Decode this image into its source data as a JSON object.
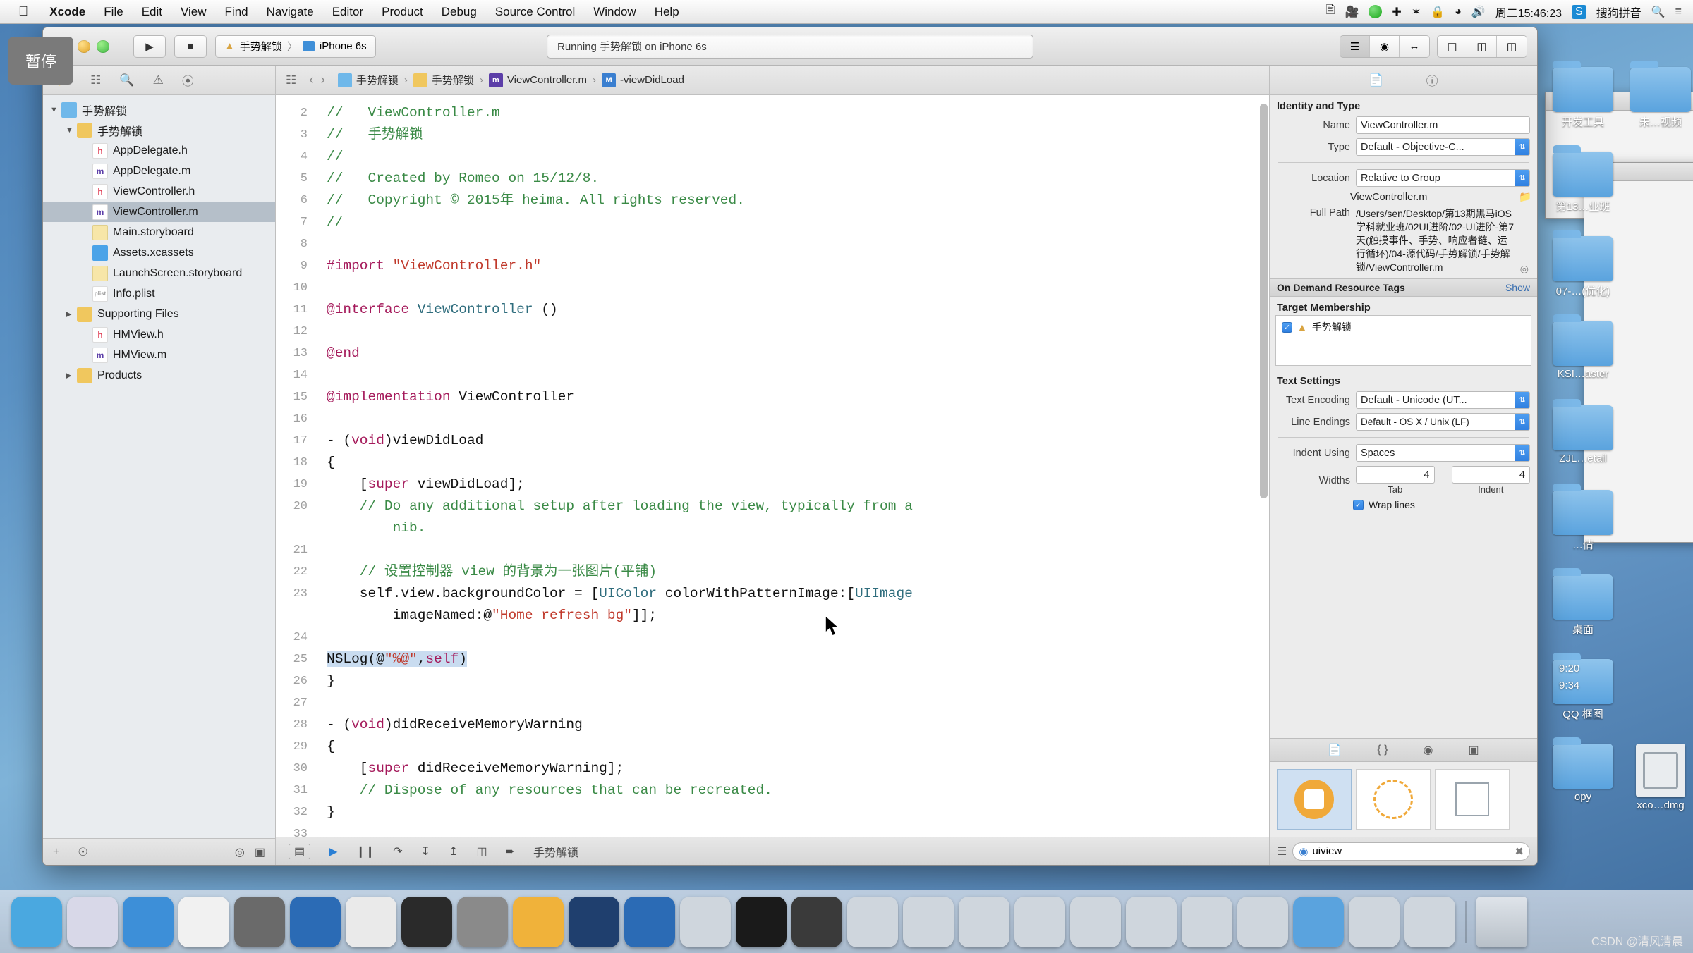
{
  "menubar": {
    "apple": "",
    "items": [
      "Xcode",
      "File",
      "Edit",
      "View",
      "Find",
      "Navigate",
      "Editor",
      "Product",
      "Debug",
      "Source Control",
      "Window",
      "Help"
    ],
    "status_icons": [
      "screen-share-icon",
      "screen-record-icon",
      "play-circle-icon",
      "airplane-icon",
      "bluetooth-icon",
      "lock-icon",
      "wifi-icon",
      "volume-icon"
    ],
    "clock": "周二15:46:23",
    "input_method_badge": "S",
    "input_method": "搜狗拼音",
    "search_icon": "search-icon",
    "notification_icon": "notification-list-icon"
  },
  "tooltip": {
    "text": "暂停"
  },
  "toolbar": {
    "run_icon": "▶",
    "stop_icon": "■",
    "scheme_project": "手势解锁",
    "scheme_separator": "〉",
    "scheme_device": "iPhone 6s",
    "status": "Running 手势解锁 on iPhone 6s",
    "editor_modes": [
      "standard-editor-icon",
      "assistant-editor-icon",
      "version-editor-icon"
    ],
    "view_toggles": [
      "navigator-toggle-icon",
      "debug-toggle-icon",
      "utilities-toggle-icon"
    ]
  },
  "navigator": {
    "tabs": [
      "project-navigator-icon",
      "symbol-navigator-icon",
      "find-navigator-icon",
      "issue-navigator-icon",
      "test-navigator-icon"
    ],
    "tree": [
      {
        "label": "手势解锁",
        "icon": "proj",
        "depth": 0,
        "tri": "▼",
        "selected": false
      },
      {
        "label": "手势解锁",
        "icon": "folder",
        "depth": 1,
        "tri": "▼",
        "selected": false
      },
      {
        "label": "AppDelegate.h",
        "icon": "h",
        "depth": 2,
        "tri": "",
        "selected": false
      },
      {
        "label": "AppDelegate.m",
        "icon": "m",
        "depth": 2,
        "tri": "",
        "selected": false
      },
      {
        "label": "ViewController.h",
        "icon": "h",
        "depth": 2,
        "tri": "",
        "selected": false
      },
      {
        "label": "ViewController.m",
        "icon": "m",
        "depth": 2,
        "tri": "",
        "selected": true
      },
      {
        "label": "Main.storyboard",
        "icon": "sb",
        "depth": 2,
        "tri": "",
        "selected": false
      },
      {
        "label": "Assets.xcassets",
        "icon": "xc",
        "depth": 2,
        "tri": "",
        "selected": false
      },
      {
        "label": "LaunchScreen.storyboard",
        "icon": "sb",
        "depth": 2,
        "tri": "",
        "selected": false
      },
      {
        "label": "Info.plist",
        "icon": "plist",
        "depth": 2,
        "tri": "",
        "selected": false
      },
      {
        "label": "Supporting Files",
        "icon": "folder",
        "depth": 1,
        "tri": "▶",
        "selected": false
      },
      {
        "label": "HMView.h",
        "icon": "h",
        "depth": 2,
        "tri": "",
        "selected": false
      },
      {
        "label": "HMView.m",
        "icon": "m",
        "depth": 2,
        "tri": "",
        "selected": false
      },
      {
        "label": "Products",
        "icon": "folder",
        "depth": 1,
        "tri": "▶",
        "selected": false
      }
    ],
    "footer_icons": [
      "add-icon",
      "filter-icon",
      "recent-icon",
      "source-control-icon"
    ]
  },
  "jumpbar": {
    "related_icon": "related-files-icon",
    "back_icon": "‹",
    "forward_icon": "›",
    "crumbs": [
      {
        "label": "手势解锁",
        "icon": "proj"
      },
      {
        "label": "手势解锁",
        "icon": "folder"
      },
      {
        "label": "ViewController.m",
        "icon": "m"
      },
      {
        "label": "-viewDidLoad",
        "icon": "M"
      }
    ]
  },
  "editor": {
    "first_line_number": 2,
    "lines": [
      {
        "n": 2,
        "tokens": [
          {
            "t": "//   ViewController.m",
            "c": "cm"
          }
        ]
      },
      {
        "n": 3,
        "tokens": [
          {
            "t": "//   手势解锁",
            "c": "cm"
          }
        ]
      },
      {
        "n": 4,
        "tokens": [
          {
            "t": "//",
            "c": "cm"
          }
        ]
      },
      {
        "n": 5,
        "tokens": [
          {
            "t": "//   Created by Romeo on 15/12/8.",
            "c": "cm"
          }
        ]
      },
      {
        "n": 6,
        "tokens": [
          {
            "t": "//   Copyright © 2015年 heima. All rights reserved.",
            "c": "cm"
          }
        ]
      },
      {
        "n": 7,
        "tokens": [
          {
            "t": "//",
            "c": "cm"
          }
        ]
      },
      {
        "n": 8,
        "tokens": [
          {
            "t": "",
            "c": ""
          }
        ]
      },
      {
        "n": 9,
        "tokens": [
          {
            "t": "#import ",
            "c": "pre"
          },
          {
            "t": "\"ViewController.h\"",
            "c": "str"
          }
        ]
      },
      {
        "n": 10,
        "tokens": [
          {
            "t": "",
            "c": ""
          }
        ]
      },
      {
        "n": 11,
        "tokens": [
          {
            "t": "@interface ",
            "c": "kw"
          },
          {
            "t": "ViewController",
            "c": "ty"
          },
          {
            "t": " ()",
            "c": ""
          }
        ]
      },
      {
        "n": 12,
        "tokens": [
          {
            "t": "",
            "c": ""
          }
        ]
      },
      {
        "n": 13,
        "tokens": [
          {
            "t": "@end",
            "c": "kw"
          }
        ]
      },
      {
        "n": 14,
        "tokens": [
          {
            "t": "",
            "c": ""
          }
        ]
      },
      {
        "n": 15,
        "tokens": [
          {
            "t": "@implementation ",
            "c": "kw"
          },
          {
            "t": "ViewController",
            "c": ""
          }
        ]
      },
      {
        "n": 16,
        "tokens": [
          {
            "t": "",
            "c": ""
          }
        ]
      },
      {
        "n": 17,
        "tokens": [
          {
            "t": "- (",
            "c": ""
          },
          {
            "t": "void",
            "c": "kw"
          },
          {
            "t": ")viewDidLoad",
            "c": ""
          }
        ]
      },
      {
        "n": 18,
        "tokens": [
          {
            "t": "{",
            "c": ""
          }
        ]
      },
      {
        "n": 19,
        "tokens": [
          {
            "t": "    [",
            "c": ""
          },
          {
            "t": "super",
            "c": "kw"
          },
          {
            "t": " viewDidLoad];",
            "c": ""
          }
        ]
      },
      {
        "n": 20,
        "tokens": [
          {
            "t": "    // Do any additional setup after loading the view, typically from a",
            "c": "cm"
          }
        ]
      },
      {
        "n": "",
        "tokens": [
          {
            "t": "        nib.",
            "c": "cm"
          }
        ]
      },
      {
        "n": 21,
        "tokens": [
          {
            "t": "",
            "c": ""
          }
        ]
      },
      {
        "n": 22,
        "tokens": [
          {
            "t": "    // 设置控制器 view 的背景为一张图片(平铺)",
            "c": "cm"
          }
        ]
      },
      {
        "n": 23,
        "tokens": [
          {
            "t": "    self.view.backgroundColor = [",
            "c": ""
          },
          {
            "t": "UIColor",
            "c": "ty"
          },
          {
            "t": " colorWithPatternImage:[",
            "c": ""
          },
          {
            "t": "UIImage",
            "c": "ty"
          }
        ]
      },
      {
        "n": "",
        "tokens": [
          {
            "t": "        imageNamed:@",
            "c": ""
          },
          {
            "t": "\"Home_refresh_bg\"",
            "c": "str"
          },
          {
            "t": "]];",
            "c": ""
          }
        ]
      },
      {
        "n": 24,
        "tokens": [
          {
            "t": "",
            "c": ""
          }
        ]
      },
      {
        "n": 25,
        "tokens": [
          {
            "t": "NSLog(@",
            "c": "",
            "sel": true
          },
          {
            "t": "\"%@\"",
            "c": "str",
            "sel": true
          },
          {
            "t": ",",
            "c": "",
            "sel": true
          },
          {
            "t": "self",
            "c": "kw",
            "sel": true
          },
          {
            "t": ")",
            "c": "",
            "sel": true
          }
        ]
      },
      {
        "n": 26,
        "tokens": [
          {
            "t": "}",
            "c": ""
          }
        ]
      },
      {
        "n": 27,
        "tokens": [
          {
            "t": "",
            "c": ""
          }
        ]
      },
      {
        "n": 28,
        "tokens": [
          {
            "t": "- (",
            "c": ""
          },
          {
            "t": "void",
            "c": "kw"
          },
          {
            "t": ")didReceiveMemoryWarning",
            "c": ""
          }
        ]
      },
      {
        "n": 29,
        "tokens": [
          {
            "t": "{",
            "c": ""
          }
        ]
      },
      {
        "n": 30,
        "tokens": [
          {
            "t": "    [",
            "c": ""
          },
          {
            "t": "super",
            "c": "kw"
          },
          {
            "t": " didReceiveMemoryWarning];",
            "c": ""
          }
        ]
      },
      {
        "n": 31,
        "tokens": [
          {
            "t": "    // Dispose of any resources that can be recreated.",
            "c": "cm"
          }
        ]
      },
      {
        "n": 32,
        "tokens": [
          {
            "t": "}",
            "c": ""
          }
        ]
      },
      {
        "n": 33,
        "tokens": [
          {
            "t": "",
            "c": ""
          }
        ]
      }
    ],
    "footer": {
      "icons": [
        "console-toggle-icon",
        "continue-icon",
        "pause-icon",
        "step-over-icon",
        "step-into-icon",
        "step-out-icon",
        "view-hierarchy-icon",
        "location-icon"
      ],
      "label": "手势解锁"
    }
  },
  "inspector": {
    "tabs": [
      "file-inspector-icon",
      "quick-help-icon"
    ],
    "identity": {
      "header": "Identity and Type",
      "name_label": "Name",
      "name_value": "ViewController.m",
      "type_label": "Type",
      "type_value": "Default - Objective-C...",
      "location_label": "Location",
      "location_value": "Relative to Group",
      "location_file": "ViewController.m",
      "fullpath_label": "Full Path",
      "fullpath_value": "/Users/sen/Desktop/第13期黑马iOS学科就业班/02UI进阶/02-UI进阶-第7天(触摸事件、手势、响应者链、运行循环)/04-源代码/手势解锁/手势解锁/ViewController.m"
    },
    "ondemand": {
      "header": "On Demand Resource Tags",
      "show": "Show"
    },
    "target_membership": {
      "header": "Target Membership",
      "items": [
        {
          "label": "手势解锁",
          "checked": true
        }
      ]
    },
    "text_settings": {
      "header": "Text Settings",
      "encoding_label": "Text Encoding",
      "encoding_value": "Default - Unicode (UT...",
      "endings_label": "Line Endings",
      "endings_value": "Default - OS X / Unix (LF)",
      "indent_label": "Indent Using",
      "indent_value": "Spaces",
      "widths_label": "Widths",
      "tab_value": "4",
      "tab_sub": "Tab",
      "indent_value_num": "4",
      "indent_sub": "Indent",
      "wrap_label": "Wrap lines",
      "wrap_checked": true
    },
    "library": {
      "tabs": [
        "file-template-library-icon",
        "code-snippet-library-icon",
        "object-library-icon",
        "media-library-icon"
      ],
      "search_value": "uiview",
      "search_icon": "search-icon",
      "clear_icon": "clear-icon",
      "list_icon": "list-view-icon"
    }
  },
  "desktop": {
    "folders": [
      {
        "label": "开发工具",
        "kind": "folder"
      },
      {
        "label": "未…视频",
        "kind": "folder"
      },
      {
        "label": "第13…业班",
        "kind": "folder"
      },
      {
        "label": "07-…(优化)",
        "kind": "folder"
      },
      {
        "label": "KSI…aster",
        "kind": "folder"
      },
      {
        "label": "ZJL…etail",
        "kind": "folder"
      },
      {
        "label": "…情",
        "kind": "folder"
      },
      {
        "label": "桌面",
        "kind": "folder"
      },
      {
        "label": "QQ 框图",
        "kind": "folder"
      },
      {
        "label": "opy",
        "kind": "text"
      },
      {
        "label": "xco…dmg",
        "kind": "dmg"
      }
    ],
    "time_labels": [
      "9:20",
      "9:34"
    ]
  },
  "dock": {
    "items": [
      "finder-icon",
      "launchpad-icon",
      "safari-icon",
      "contacts-icon",
      "imovie-icon",
      "xcode-icon",
      "preview-icon",
      "terminal-icon",
      "system-preferences-icon",
      "sketch-icon",
      "photoshop-icon",
      "xcode-active-icon",
      "simulator-icon",
      "iterm-icon",
      "quicktime-icon",
      "screen-1-icon",
      "screen-2-icon",
      "screen-3-icon",
      "screen-4-icon",
      "screen-5-icon",
      "screen-6-icon",
      "screen-7-icon",
      "screen-8-icon",
      "finder-window-icon",
      "screen-9-icon",
      "screen-10-icon",
      "trash-icon"
    ]
  },
  "watermark": "CSDN @清风清晨"
}
